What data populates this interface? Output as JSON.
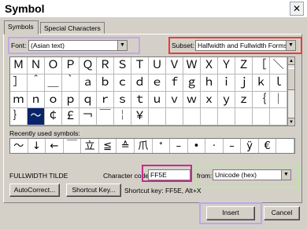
{
  "window": {
    "title": "Symbol",
    "close_glyph": "✕"
  },
  "tabs": [
    {
      "label": "Symbols",
      "mnemonic": "S",
      "active": true
    },
    {
      "label": "Special Characters",
      "mnemonic": "P",
      "active": false
    }
  ],
  "font": {
    "label": "Font:",
    "value": "(Asian text)"
  },
  "subset": {
    "label": "Subset:",
    "value": "Halfwidth and Fullwidth Forms"
  },
  "symbol_grid": [
    [
      "Ｍ",
      "Ｎ",
      "Ｏ",
      "Ｐ",
      "Ｑ",
      "Ｒ",
      "Ｓ",
      "Ｔ",
      "Ｕ",
      "Ｖ",
      "Ｗ",
      "Ｘ",
      "Ｙ",
      "Ｚ",
      "［",
      "＼"
    ],
    [
      "］",
      "＾",
      "＿",
      "｀",
      "ａ",
      "ｂ",
      "ｃ",
      "ｄ",
      "ｅ",
      "ｆ",
      "ｇ",
      "ｈ",
      "ｉ",
      "ｊ",
      "ｋ",
      "ｌ"
    ],
    [
      "ｍ",
      "ｎ",
      "ｏ",
      "ｐ",
      "ｑ",
      "ｒ",
      "ｓ",
      "ｔ",
      "ｕ",
      "ｖ",
      "ｗ",
      "ｘ",
      "ｙ",
      "ｚ",
      "｛",
      "｜"
    ],
    [
      "｝",
      "～",
      "￠",
      "￡",
      "￢",
      "￣",
      "￤",
      "￥",
      "",
      "",
      "",
      "",
      "",
      "",
      "",
      ""
    ]
  ],
  "selected_cell": {
    "row": 3,
    "col": 1
  },
  "recent": {
    "label": "Recently used symbols:",
    "symbols": [
      "～",
      "↓",
      "←",
      "￣",
      "立",
      "≦",
      "≙",
      "爪",
      "ᐩ",
      "–",
      "•",
      "·",
      "–",
      "ÿ",
      "€",
      ""
    ]
  },
  "character_name": "FULLWIDTH TILDE",
  "character_code": {
    "label": "Character code:",
    "value": "FF5E"
  },
  "from": {
    "label": "from:",
    "value": "Unicode (hex)"
  },
  "buttons": {
    "autocorrect": "AutoCorrect...",
    "shortcut_key": "Shortcut Key...",
    "insert": "Insert",
    "cancel": "Cancel"
  },
  "shortcut_text": "Shortcut key: FF5E, Alt+X",
  "highlight_colors": {
    "font": "#c6a6e8",
    "subset": "#e83c3c",
    "character_code": "#c42c8a",
    "from": "#bde6a0",
    "insert": "#b9a7f0"
  }
}
